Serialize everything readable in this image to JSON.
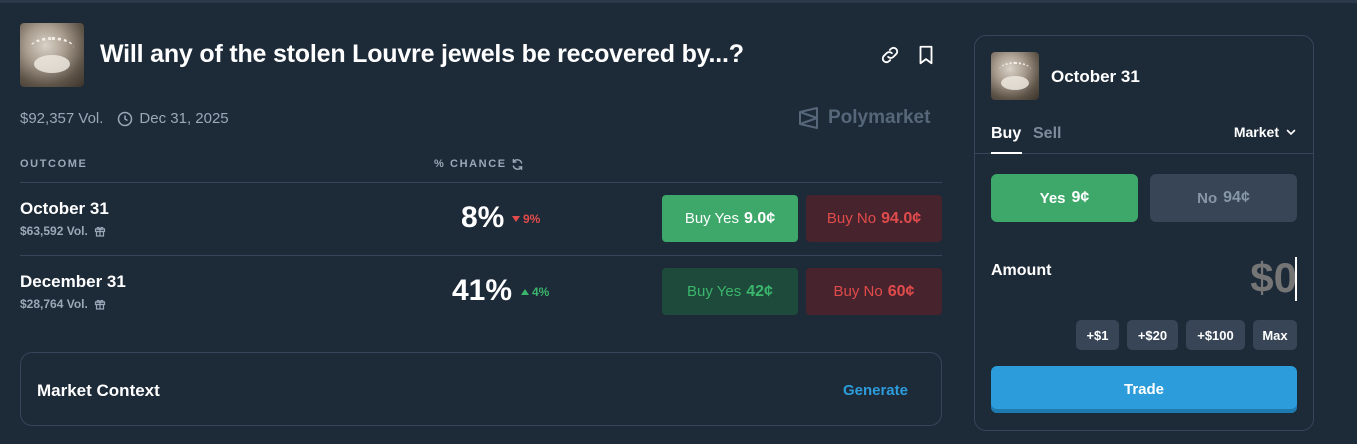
{
  "market": {
    "title": "Will any of the stolen Louvre jewels be recovered by...?",
    "volume": "$92,357 Vol.",
    "end_date": "Dec 31, 2025",
    "brand": "Polymarket"
  },
  "table": {
    "headers": {
      "outcome": "OUTCOME",
      "chance": "% CHANCE"
    },
    "rows": [
      {
        "name": "October 31",
        "volume": "$63,592 Vol.",
        "chance": "8%",
        "change": "9%",
        "change_direction": "down",
        "buy_yes_label": "Buy Yes",
        "buy_yes_price": "9.0¢",
        "buy_no_label": "Buy No",
        "buy_no_price": "94.0¢"
      },
      {
        "name": "December 31",
        "volume": "$28,764 Vol.",
        "chance": "41%",
        "change": "4%",
        "change_direction": "up",
        "buy_yes_label": "Buy Yes",
        "buy_yes_price": "42¢",
        "buy_no_label": "Buy No",
        "buy_no_price": "60¢"
      }
    ]
  },
  "context": {
    "label": "Market Context",
    "action": "Generate"
  },
  "panel": {
    "outcome": "October 31",
    "tabs": [
      "Buy",
      "Sell"
    ],
    "order_type": "Market",
    "yes_label": "Yes",
    "yes_price": "9¢",
    "no_label": "No",
    "no_price": "94¢",
    "amount_label": "Amount",
    "amount_placeholder": "$0",
    "chips": [
      "+$1",
      "+$20",
      "+$100",
      "Max"
    ],
    "trade_label": "Trade"
  },
  "colors": {
    "background": "#1d2a38",
    "green": "#3ea86a",
    "red": "#e24b4b",
    "blue": "#2d9cdb"
  }
}
